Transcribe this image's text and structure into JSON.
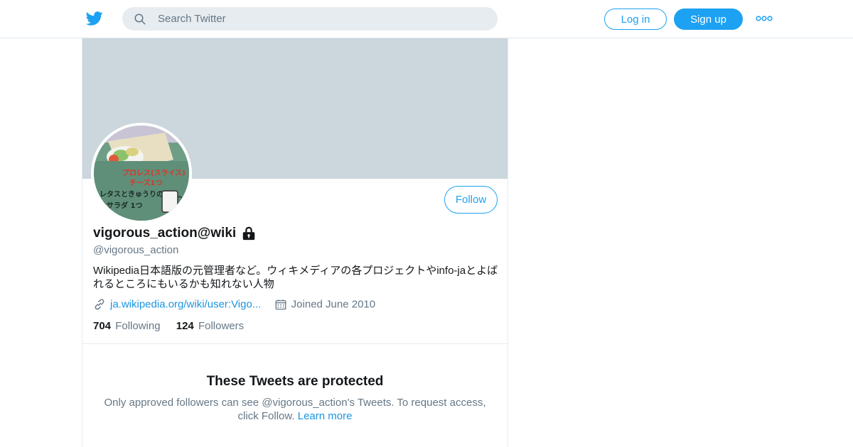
{
  "colors": {
    "brand": "#1da1f2",
    "link": "#1b95e0",
    "muted_text": "#657786",
    "banner": "#ccd6dd",
    "search_bg": "#e6ecf0"
  },
  "nav": {
    "logo_icon": "twitter-bird-icon",
    "search": {
      "icon": "search-icon",
      "placeholder": "Search Twitter",
      "value": ""
    },
    "login_label": "Log in",
    "signup_label": "Sign up",
    "more_icon": "more-dots-icon"
  },
  "profile": {
    "display_name": "vigorous_action@wiki",
    "protected_icon": "lock-icon",
    "handle": "@vigorous_action",
    "follow_label": "Follow",
    "bio_line1": "Wikipedia日本語版の元管理者など。ウィキメディアの各プロジェクトやinfo-jaとよば",
    "bio_line2": "れるところにもいるかも知れない人物",
    "avatar": {
      "icon": "avatar-image",
      "text_line1": "プロレス(スライス)",
      "text_line2": "チーズ1つ",
      "text_line3": "レタスときゅうりの",
      "text_line4": "サラダ  1つ"
    },
    "website": {
      "icon": "link-icon",
      "label": "ja.wikipedia.org/wiki/user:Vigo..."
    },
    "joined": {
      "icon": "calendar-icon",
      "label": "Joined June 2010"
    },
    "following_count": "704",
    "following_label": "Following",
    "followers_count": "124",
    "followers_label": "Followers"
  },
  "protected_notice": {
    "title": "These Tweets are protected",
    "body_line1": "Only approved followers can see @vigorous_action's Tweets. To request access,",
    "body_line2": "click Follow.",
    "learn_more": "Learn more"
  }
}
